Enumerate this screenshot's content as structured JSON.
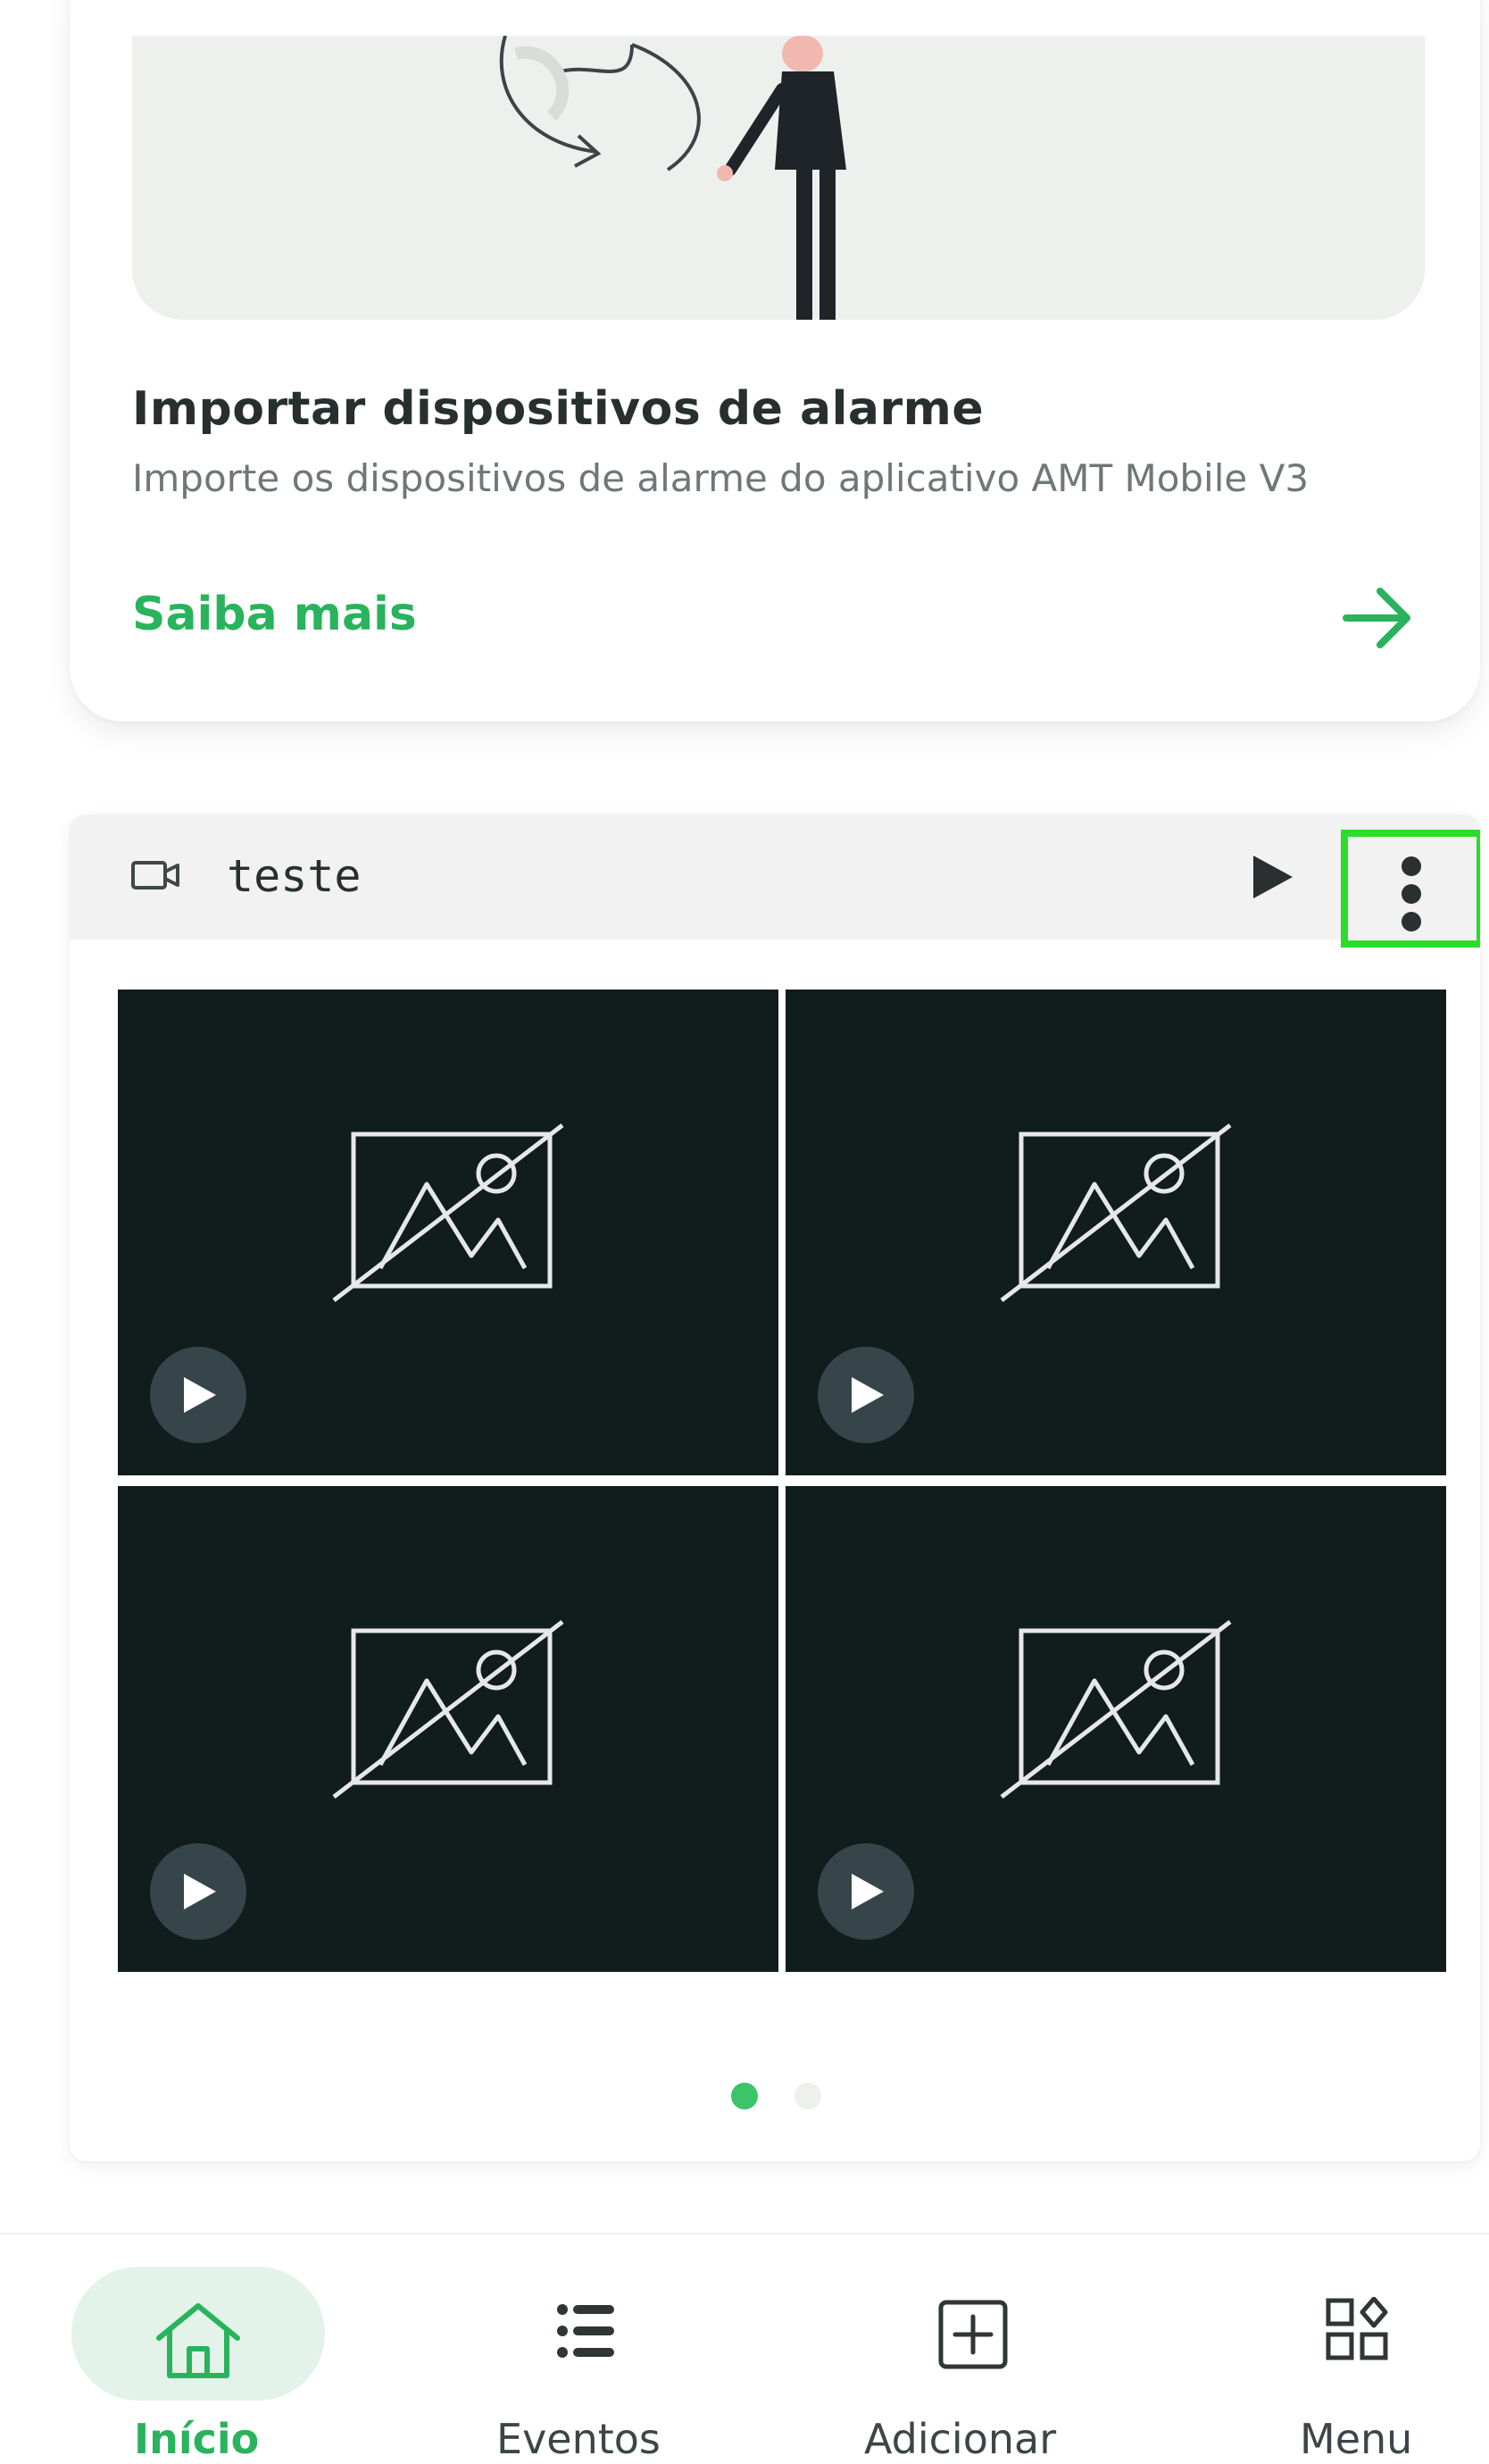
{
  "promo_card": {
    "title": "Importar dispositivos de alarme",
    "description": "Importe os dispositivos de alarme do aplicativo AMT Mobile V3",
    "link_label": "Saiba mais"
  },
  "camera_group": {
    "title": "teste",
    "tiles": [
      {
        "icon": "no-image-icon"
      },
      {
        "icon": "no-image-icon"
      },
      {
        "icon": "no-image-icon"
      },
      {
        "icon": "no-image-icon"
      }
    ],
    "pager": {
      "total_pages": 2,
      "current_page": 1
    }
  },
  "bottom_nav": {
    "items": [
      {
        "label": "Início",
        "icon": "home-icon",
        "active": true
      },
      {
        "label": "Eventos",
        "icon": "list-icon",
        "active": false
      },
      {
        "label": "Adicionar",
        "icon": "add-square-icon",
        "active": false
      },
      {
        "label": "Menu",
        "icon": "grid-menu-icon",
        "active": false
      }
    ]
  },
  "colors": {
    "accent": "#29b35c",
    "tile_background": "#111c1c",
    "highlight": "#2bdc2b"
  }
}
